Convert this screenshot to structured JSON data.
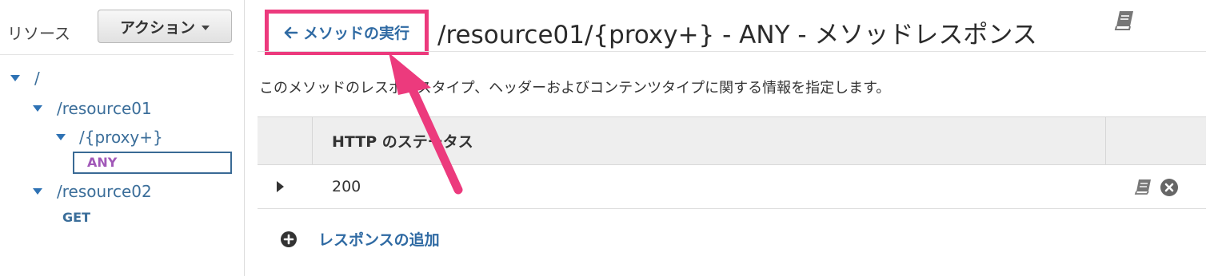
{
  "sidebar": {
    "resources_label": "リソース",
    "actions_label": "アクション",
    "tree": {
      "root": "/",
      "resource01": "/resource01",
      "proxy": "/{proxy+}",
      "any_method": "ANY",
      "resource02": "/resource02",
      "get_method": "GET"
    }
  },
  "header": {
    "back_label": "メソッドの実行",
    "title": "/resource01/{proxy+} - ANY - メソッドレスポンス"
  },
  "main": {
    "description": "このメソッドのレスポンスタイプ、ヘッダーおよびコンテンツタイプに関する情報を指定します。",
    "table": {
      "column_header": "HTTP のステータス",
      "rows": [
        {
          "status": "200"
        }
      ]
    },
    "add_response_label": "レスポンスの追加"
  },
  "icons": {
    "back": "arrow-left-icon",
    "book": "book-icon",
    "remove": "close-circle-icon",
    "add": "plus-circle-icon",
    "expand": "caret-right-icon"
  },
  "colors": {
    "highlight": "#ec3a7d",
    "link": "#2f6aa3",
    "method_any": "#a158b8"
  }
}
